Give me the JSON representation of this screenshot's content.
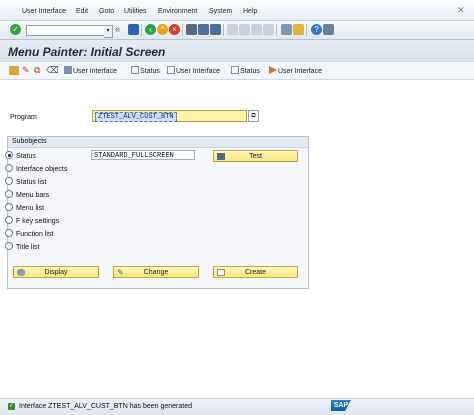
{
  "menubar": {
    "items": [
      "User Interface",
      "Edit",
      "Goto",
      "Utilities",
      "Environment",
      "System",
      "Help"
    ]
  },
  "toolbar": {
    "command_placeholder": "",
    "icons": [
      "enter-icon",
      "save-icon",
      "back-icon",
      "exit-icon",
      "cancel-icon",
      "print-icon",
      "find-icon",
      "find-next-icon",
      "first-page-icon",
      "prev-page-icon",
      "next-page-icon",
      "last-page-icon",
      "new-session-icon",
      "shortcut-icon",
      "help-icon",
      "customize-icon"
    ]
  },
  "title": "Menu Painter: Initial Screen",
  "app_toolbar": {
    "items": [
      "User Interface",
      "Status",
      "User Interface",
      "Status",
      "User Interface"
    ]
  },
  "program": {
    "label": "Program",
    "value": "ZTEST_ALV_CUST_BTN"
  },
  "subobjects": {
    "title": "Subobjects",
    "selected": "Status",
    "options": [
      "Status",
      "Interface objects",
      "Status list",
      "Menu bars",
      "Menu list",
      "F key settings",
      "Function list",
      "Title list"
    ],
    "status_value": "STANDARD_FULLSCREEN",
    "test_label": "Test"
  },
  "actions": {
    "display": "Display",
    "change": "Change",
    "create": "Create"
  },
  "statusbar": {
    "message": "Interface ZTEST_ALV_CUST_BTN has been generated",
    "logo": "SAP"
  }
}
